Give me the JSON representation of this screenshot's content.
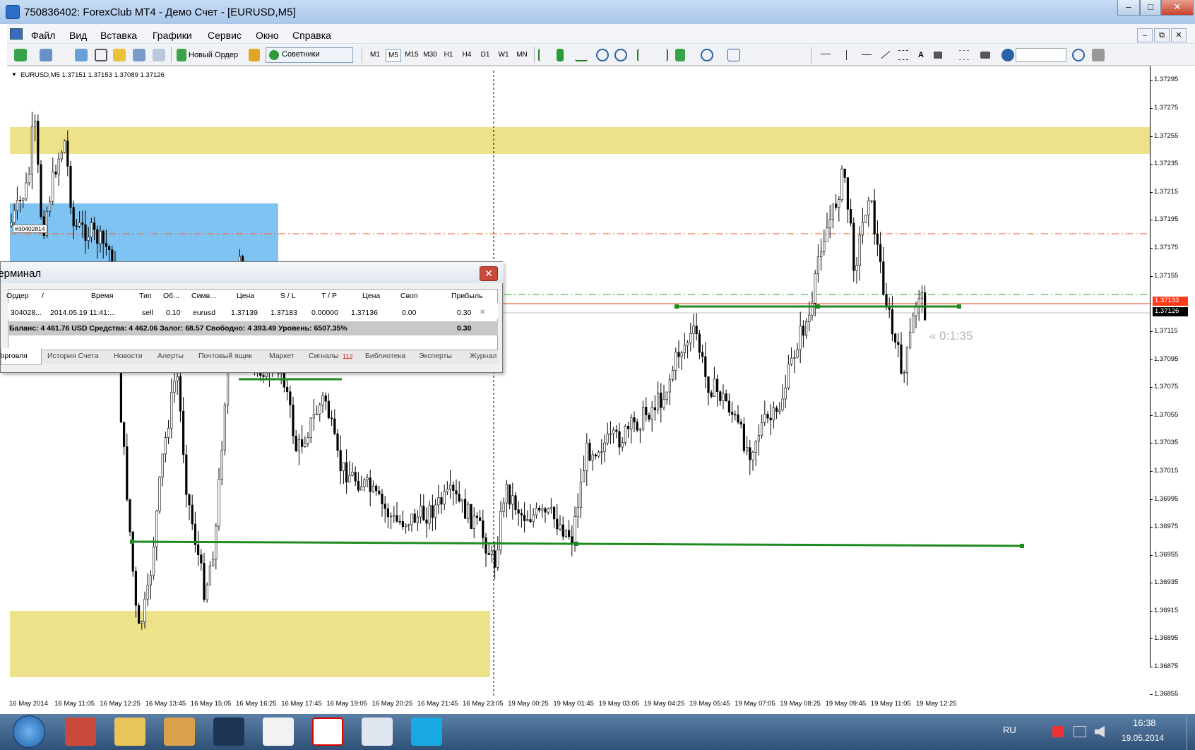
{
  "window": {
    "title": "750836402: ForexClub MT4 - Демо Счет - [EURUSD,M5]",
    "min": "–",
    "max": "□",
    "close": "✕"
  },
  "menu": [
    "Файл",
    "Вид",
    "Вставка",
    "Графики",
    "Сервис",
    "Окно",
    "Справка"
  ],
  "mdi": {
    "min": "–",
    "restore": "⧉",
    "close": "✕"
  },
  "toolbar": {
    "new_order": "Новый Ордер",
    "advisors": "Советники",
    "timeframes": [
      "M1",
      "M5",
      "M15",
      "M30",
      "H1",
      "H4",
      "D1",
      "W1",
      "MN"
    ],
    "active_tf": "M5",
    "text_tool": "A"
  },
  "chart": {
    "symbol_line": "EURUSD,M5  1.37151 1.37153 1.37089 1.37126",
    "order_tag": "#30402814",
    "countdown": "« 0:1:35",
    "ask_label": "1.37133",
    "bid_label": "1.37126",
    "price_ticks": [
      "1.37295",
      "1.37275",
      "1.37255",
      "1.37235",
      "1.37215",
      "1.37195",
      "1.37175",
      "1.37155",
      "1.37115",
      "1.37095",
      "1.37075",
      "1.37055",
      "1.37035",
      "1.37015",
      "1.36995",
      "1.36975",
      "1.36955",
      "1.36935",
      "1.36915",
      "1.36895",
      "1.36875",
      "1.36855"
    ],
    "time_ticks": [
      "16 May 2014",
      "16 May 11:05",
      "16 May 12:25",
      "16 May 13:45",
      "16 May 15:05",
      "16 May 16:25",
      "16 May 17:45",
      "16 May 19:05",
      "16 May 20:25",
      "16 May 21:45",
      "16 May 23:05",
      "19 May 00:25",
      "19 May 01:45",
      "19 May 03:05",
      "19 May 04:25",
      "19 May 05:45",
      "19 May 07:05",
      "19 May 08:25",
      "19 May 09:45",
      "19 May 11:05",
      "19 May 12:25"
    ],
    "colors": {
      "zone_yellow": "#ede28a",
      "zone_blue": "#7fc3f2",
      "trendline": "#1f8a1f",
      "sl_line": "#ff5a2a",
      "tp_line": "#2a9a2a",
      "bid_line": "#c0c0c0",
      "ask_line": "#ff3b1a"
    }
  },
  "terminal": {
    "title": "Терминал",
    "columns": [
      "Ордер",
      "/",
      "Время",
      "Тип",
      "Об...",
      "Симв...",
      "Цена",
      "S / L",
      "T / P",
      "Цена",
      "Своп",
      "Прибыль"
    ],
    "row": [
      "304028...",
      "2014.05.19 11:41:...",
      "sell",
      "0.10",
      "eurusd",
      "1.37139",
      "1.37183",
      "0.00000",
      "1.37136",
      "0.00",
      "0.30"
    ],
    "balance": "Баланс: 4 461.76 USD  Средства: 4 462.06  Залог: 68.57  Свободно: 4 393.49  Уровень: 6507.35%",
    "balance_profit": "0.30",
    "tabs": [
      "Торговля",
      "История Счета",
      "Новости",
      "Алерты",
      "Почтовый ящик",
      "Маркет",
      "Сигналы",
      "Библиотека",
      "Эксперты",
      "Журнал"
    ],
    "signals_badge": "112"
  },
  "taskbar": {
    "lang": "RU",
    "time": "16:38",
    "date": "19.05.2014"
  }
}
